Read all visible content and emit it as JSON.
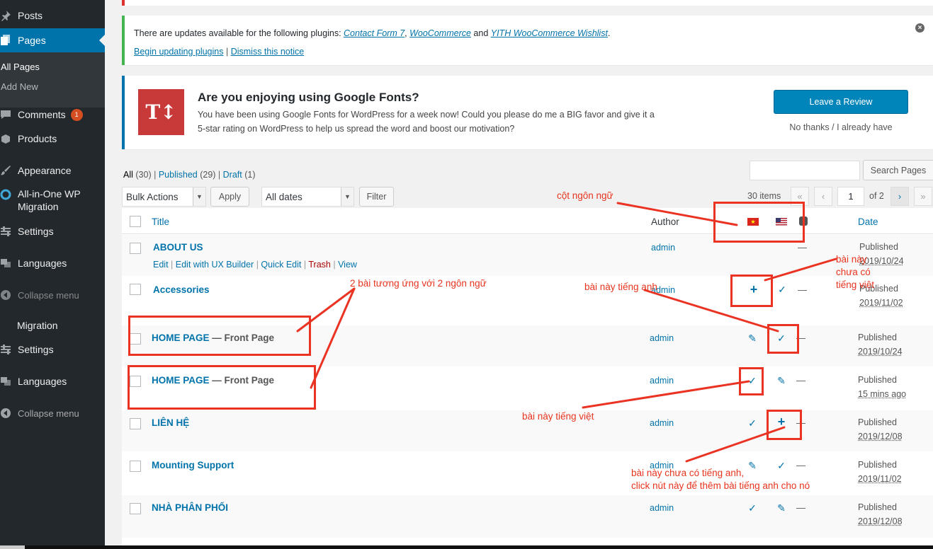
{
  "sidebar": {
    "items": [
      {
        "label": "Posts",
        "icon": "pin-icon"
      },
      {
        "label": "Pages",
        "icon": "pages-icon"
      },
      {
        "label": "All Pages"
      },
      {
        "label": "Add New"
      },
      {
        "label": "Comments",
        "icon": "comments-icon",
        "badge": "1"
      },
      {
        "label": "Products",
        "icon": "products-icon"
      },
      {
        "label": "Appearance",
        "icon": "brush-icon"
      },
      {
        "label": "All-in-One WP Migration",
        "icon": "migration-icon"
      },
      {
        "label": "Settings",
        "icon": "settings-icon"
      },
      {
        "label": "Languages",
        "icon": "languages-icon"
      },
      {
        "label": "Collapse menu",
        "icon": "collapse-icon"
      },
      {
        "label": "Migration"
      },
      {
        "label": "Settings",
        "icon": "settings-icon"
      },
      {
        "label": "Languages",
        "icon": "languages-icon"
      },
      {
        "label": "Collapse menu",
        "icon": "collapse-icon"
      }
    ]
  },
  "notices": {
    "updates": {
      "text_before": "There are updates available for the following plugins: ",
      "plugins": [
        "Contact Form 7",
        "WooCommerce",
        "YITH WooCommerce Wishlist"
      ],
      "sep1": ", ",
      "sep2": " and ",
      "period": ".",
      "begin_link": "Begin updating plugins",
      "pipe": " | ",
      "dismiss_link": "Dismiss this notice"
    },
    "google_fonts": {
      "logo": "T↕",
      "title": "Are you enjoying using Google Fonts?",
      "text": "You have been using Google Fonts for WordPress for a week now! Could you please do me a BIG favor and give it a 5-star rating on WordPress to help us spread the word and boost our motivation?",
      "review_button": "Leave a Review",
      "no_thanks": "No thanks / I already have"
    }
  },
  "filters": {
    "all": "All",
    "all_count": "(30)",
    "published": "Published",
    "published_count": "(29)",
    "draft": "Draft",
    "draft_count": "(1)",
    "sep": " | ",
    "search_button": "Search Pages",
    "bulk_actions": "Bulk Actions",
    "apply": "Apply",
    "all_dates": "All dates",
    "filter": "Filter",
    "items": "30 items",
    "first_page": "«",
    "prev_page": "‹",
    "current_page": "1",
    "of_pages": "of 2",
    "next_page": "›",
    "last_page": "»"
  },
  "table": {
    "columns": {
      "title": "Title",
      "author": "Author",
      "date": "Date"
    },
    "rows": [
      {
        "title": "ABOUT US",
        "suffix": "",
        "author": "admin",
        "status": "Published",
        "date": "2019/10/24",
        "vi": "",
        "en": "",
        "actions": [
          "Edit",
          "Edit with UX Builder",
          "Quick Edit",
          "Trash",
          "View"
        ]
      },
      {
        "title": "Accessories",
        "suffix": "",
        "author": "admin",
        "status": "Published",
        "date": "2019/11/02",
        "vi": "plus",
        "en": "check"
      },
      {
        "title": "HOME PAGE",
        "suffix": " — Front Page",
        "author": "admin",
        "status": "Published",
        "date": "2019/10/24",
        "vi": "edit",
        "en": "check"
      },
      {
        "title": "HOME PAGE",
        "suffix": " — Front Page",
        "author": "admin",
        "status": "Published",
        "date": "15 mins ago",
        "vi": "check",
        "en": "edit"
      },
      {
        "title": "LIÊN HỆ",
        "suffix": "",
        "author": "admin",
        "status": "Published",
        "date": "2019/12/08",
        "vi": "check",
        "en": "plus"
      },
      {
        "title": "Mounting Support",
        "suffix": "",
        "author": "admin",
        "status": "Published",
        "date": "2019/11/02",
        "vi": "edit",
        "en": "check"
      },
      {
        "title": "NHÀ PHÂN PHỐI",
        "suffix": "",
        "author": "admin",
        "status": "Published",
        "date": "2019/12/08",
        "vi": "check",
        "en": "edit"
      }
    ],
    "dash": "—"
  },
  "annotations": {
    "lang_column": "cột ngôn ngữ",
    "two_posts": "2 bài tương ứng với 2 ngôn ngữ",
    "english_post": "bài này tiếng anh",
    "no_vi_line1": "bài này",
    "no_vi_line2": "chưa có",
    "no_vi_line3": "tiếng việt",
    "vietnamese_post": "bài này tiếng việt",
    "no_en_line1": "bài này chưa có tiếng anh,",
    "no_en_line2": "click nút này để thêm bài tiếng anh cho nó"
  },
  "colors": {
    "accent": "#0073aa",
    "annotation": "#ea3323",
    "sidebar": "#23282d"
  }
}
